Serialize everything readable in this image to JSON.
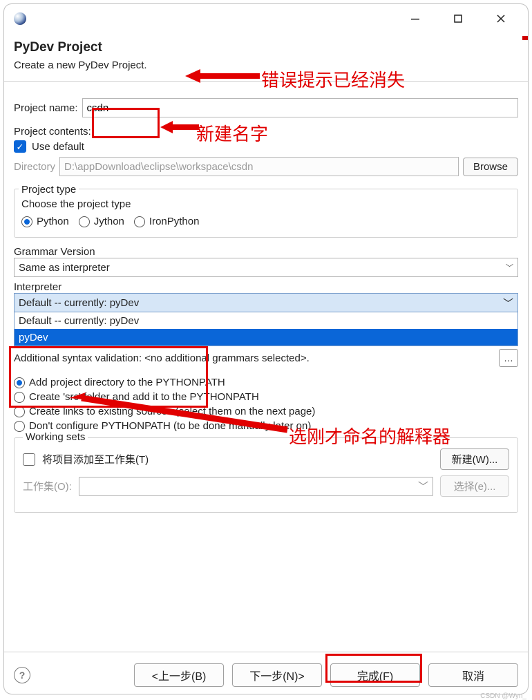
{
  "titlebar": {
    "min_tooltip": "Minimize",
    "max_tooltip": "Maximize",
    "close_tooltip": "Close"
  },
  "header": {
    "title": "PyDev Project",
    "subtitle": "Create a new PyDev Project."
  },
  "form": {
    "project_name_label": "Project name:",
    "project_name_value": "csdn",
    "project_contents_label": "Project contents:",
    "use_default_label": "Use default",
    "directory_label": "Directory",
    "directory_value": "D:\\appDownload\\eclipse\\workspace\\csdn",
    "browse_label": "Browse",
    "project_type_legend": "Project type",
    "project_type_choose": "Choose the project type",
    "project_type_options": [
      "Python",
      "Jython",
      "IronPython"
    ],
    "grammar_label": "Grammar Version",
    "grammar_value": "Same as interpreter",
    "interpreter_label": "Interpreter",
    "interpreter_selected": "Default  --  currently: pyDev",
    "interpreter_options": [
      "Default  --  currently: pyDev",
      "pyDev"
    ],
    "syntax_label": "Additional syntax validation: <no additional grammars selected>.",
    "radios": {
      "r1": "Add project directory to the PYTHONPATH",
      "r2": "Create 'src' folder and add it to the PYTHONPATH",
      "r3": "Create links to existing sources (select them on the next page)",
      "r4": "Don't configure PYTHONPATH (to be done manually later on)"
    },
    "ws_legend": "Working sets",
    "ws_add_label": "将项目添加至工作集(T)",
    "ws_new_label": "新建(W)...",
    "ws_sets_label": "工作集(O):",
    "ws_select_label": "选择(e)..."
  },
  "footer": {
    "back": "<上一步(B)",
    "next": "下一步(N)>",
    "finish": "完成(F)",
    "cancel": "取消"
  },
  "annotations": {
    "a1": "错误提示已经消失",
    "a2": "新建名字",
    "a3": "选刚才命名的解释器"
  },
  "watermark": "CSDN @Wyn_"
}
